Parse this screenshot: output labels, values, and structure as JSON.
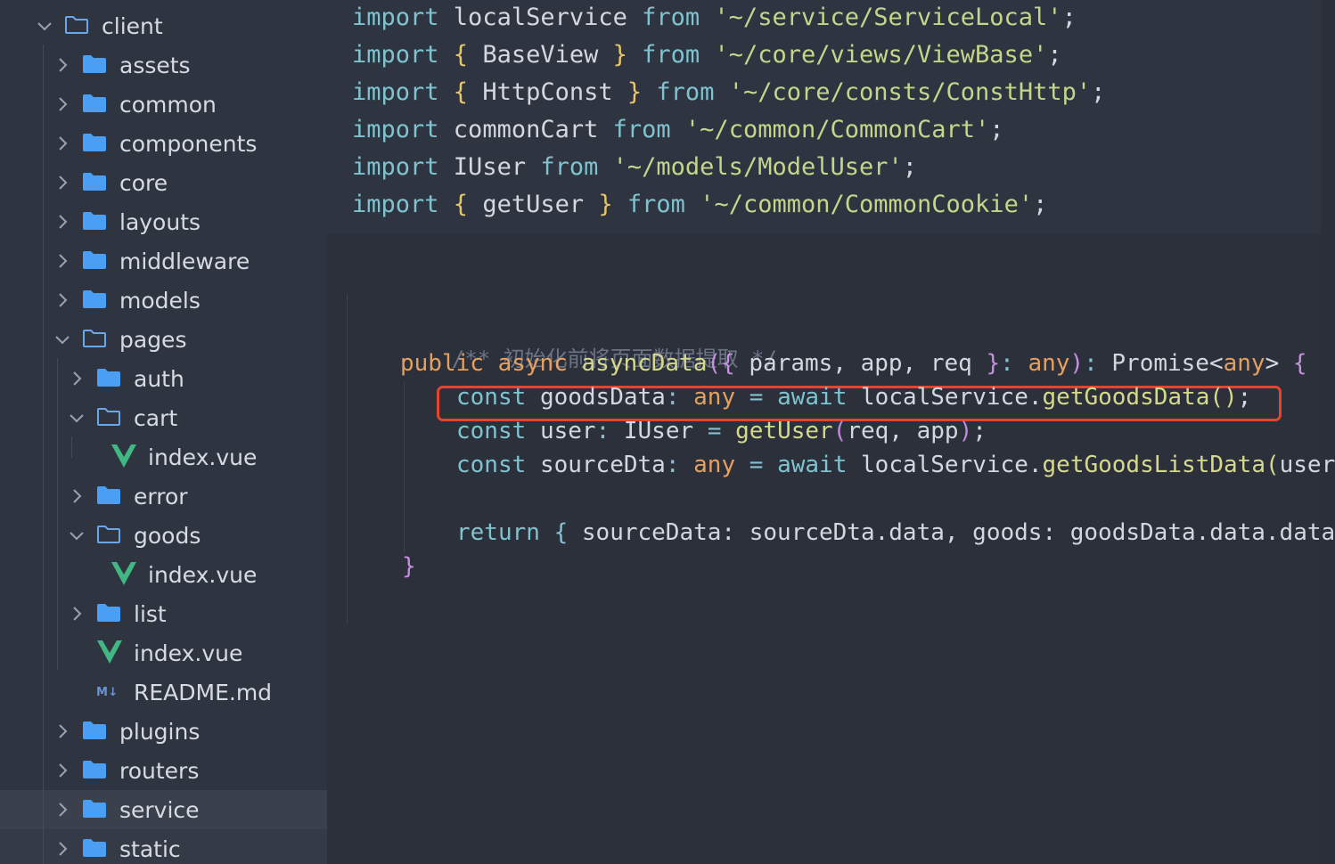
{
  "sidebar": {
    "items": [
      {
        "label": "client",
        "icon": "folder-open-icon",
        "chevron": "down"
      },
      {
        "label": "assets",
        "icon": "folder-icon",
        "chevron": "right"
      },
      {
        "label": "common",
        "icon": "folder-icon",
        "chevron": "right"
      },
      {
        "label": "components",
        "icon": "folder-icon",
        "chevron": "right"
      },
      {
        "label": "core",
        "icon": "folder-icon",
        "chevron": "right"
      },
      {
        "label": "layouts",
        "icon": "folder-icon",
        "chevron": "right"
      },
      {
        "label": "middleware",
        "icon": "folder-icon",
        "chevron": "right"
      },
      {
        "label": "models",
        "icon": "folder-icon",
        "chevron": "right"
      },
      {
        "label": "pages",
        "icon": "folder-open-icon",
        "chevron": "down"
      },
      {
        "label": "auth",
        "icon": "folder-icon",
        "chevron": "right"
      },
      {
        "label": "cart",
        "icon": "folder-open-icon",
        "chevron": "down"
      },
      {
        "label": "index.vue",
        "icon": "vue-icon",
        "chevron": "none"
      },
      {
        "label": "error",
        "icon": "folder-icon",
        "chevron": "right"
      },
      {
        "label": "goods",
        "icon": "folder-open-icon",
        "chevron": "down"
      },
      {
        "label": "index.vue",
        "icon": "vue-icon",
        "chevron": "none"
      },
      {
        "label": "list",
        "icon": "folder-icon",
        "chevron": "right"
      },
      {
        "label": "index.vue",
        "icon": "vue-icon",
        "chevron": "none"
      },
      {
        "label": "README.md",
        "icon": "markdown-icon",
        "chevron": "none"
      },
      {
        "label": "plugins",
        "icon": "folder-icon",
        "chevron": "right"
      },
      {
        "label": "routers",
        "icon": "folder-icon",
        "chevron": "right"
      },
      {
        "label": "service",
        "icon": "folder-icon",
        "chevron": "right",
        "selected": true
      },
      {
        "label": "static",
        "icon": "folder-icon",
        "chevron": "right"
      }
    ],
    "markdown_badge": "M↓"
  },
  "editor": {
    "imports": [
      {
        "kw": "import",
        "pre": " localService ",
        "from": "from",
        "path": "'~/service/ServiceLocal'",
        "end": ";"
      },
      {
        "kw": "import",
        "open": " { ",
        "name": "BaseView",
        "close": " } ",
        "from": "from",
        "path": "'~/core/views/ViewBase'",
        "end": ";"
      },
      {
        "kw": "import",
        "open": " { ",
        "name": "HttpConst",
        "close": " } ",
        "from": "from",
        "path": "'~/core/consts/ConstHttp'",
        "end": ";"
      },
      {
        "kw": "import",
        "pre": " commonCart ",
        "from": "from",
        "path": "'~/common/CommonCart'",
        "end": ";"
      },
      {
        "kw": "import",
        "pre": " IUser ",
        "from": "from",
        "path": "'~/models/ModelUser'",
        "end": ";"
      },
      {
        "kw": "import",
        "open": " { ",
        "name": "getUser",
        "close": " } ",
        "from": "from",
        "path": "'~/common/CommonCookie'",
        "end": ";"
      }
    ],
    "comment": "/** 初始化前将页面数据提取 */",
    "signature": {
      "public": "public",
      "async": "async",
      "name": "asyncData",
      "open_paren": "(",
      "open_brace": "{",
      "params": " params, app, req ",
      "close_brace": "}",
      "colon": ":",
      "any": "any",
      "close_paren": ")",
      "ret_colon": ":",
      "promise": "Promise<",
      "promise_any": "any",
      "promise_end": ">",
      "body_open": "{"
    },
    "line1": {
      "const": "const",
      "var": "goodsData",
      "colon": ":",
      "type": "any",
      "eq": "=",
      "await": "await",
      "obj": "localService.",
      "call": "getGoodsData",
      "paren": "()",
      "end": ";"
    },
    "line2": {
      "const": "const",
      "var": "user",
      "colon": ":",
      "type": "IUser",
      "eq": "=",
      "call": "getUser",
      "open": "(",
      "args": "req, app",
      "close": ")",
      "end": ";"
    },
    "line3": {
      "const": "const",
      "var": "sourceDta",
      "colon": ":",
      "type": "any",
      "eq": "=",
      "await": "await",
      "obj": "localService.",
      "call": "getGoodsListData",
      "open": "(",
      "args": "user."
    },
    "line4": {
      "ret": "return",
      "open": "{",
      "body": " sourceData: sourceDta.data, goods: goodsData.data.data,"
    },
    "close_brace": "}"
  },
  "colors": {
    "highlight_border": "#e3452d",
    "folder_blue": "#4a9ff5",
    "vue_green": "#41b883"
  }
}
